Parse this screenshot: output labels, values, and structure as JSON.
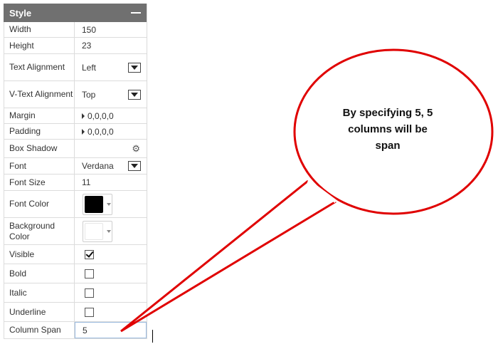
{
  "panel": {
    "title": "Style",
    "rows": {
      "width": {
        "label": "Width",
        "value": "150"
      },
      "height": {
        "label": "Height",
        "value": "23"
      },
      "text_alignment": {
        "label": "Text Alignment",
        "value": "Left"
      },
      "vtext_alignment": {
        "label": "V-Text Alignment",
        "value": "Top"
      },
      "margin": {
        "label": "Margin",
        "value": "0,0,0,0"
      },
      "padding": {
        "label": "Padding",
        "value": "0,0,0,0"
      },
      "box_shadow": {
        "label": "Box Shadow",
        "value": ""
      },
      "font": {
        "label": "Font",
        "value": "Verdana"
      },
      "font_size": {
        "label": "Font Size",
        "value": "11"
      },
      "font_color": {
        "label": "Font Color",
        "color": "#000000"
      },
      "background_color": {
        "label": "Background Color",
        "color": "#ffffff"
      },
      "visible": {
        "label": "Visible",
        "checked": true
      },
      "bold": {
        "label": "Bold",
        "checked": false
      },
      "italic": {
        "label": "Italic",
        "checked": false
      },
      "underline": {
        "label": "Underline",
        "checked": false
      },
      "column_span": {
        "label": "Column Span",
        "value": "5"
      }
    }
  },
  "callout": {
    "text": "By specifying 5, 5 columns will be span",
    "stroke_color": "#e00000"
  },
  "colors": {
    "header_bg": "#707070",
    "accent": "#e00000"
  }
}
